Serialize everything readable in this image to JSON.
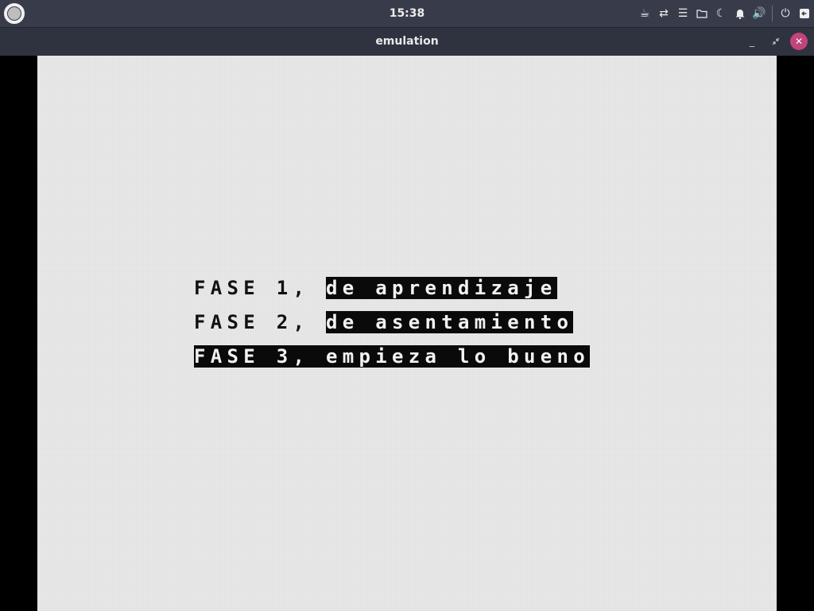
{
  "topbar": {
    "clock": "15:38",
    "icons": [
      "coffee-icon",
      "network-transfer-icon",
      "menu-icon",
      "folder-icon",
      "moon-icon",
      "bell-icon",
      "volume-icon",
      "power-icon",
      "logout-icon"
    ]
  },
  "window": {
    "title": "emulation",
    "buttons": [
      "minimize",
      "restore",
      "close"
    ]
  },
  "screen": {
    "lines": [
      {
        "normal": "FASE 1, ",
        "inverse": "de aprendizaje"
      },
      {
        "normal": "FASE 2, ",
        "inverse": "de asentamiento"
      },
      {
        "normal": "",
        "inverse": "FASE 3, empieza lo bueno"
      }
    ]
  },
  "colors": {
    "panel": "#383c4a",
    "titlebar": "#2f333f",
    "close_button": "#c1447a",
    "screen_bg": "#e8e8e8",
    "ink": "#0a0a0a"
  }
}
